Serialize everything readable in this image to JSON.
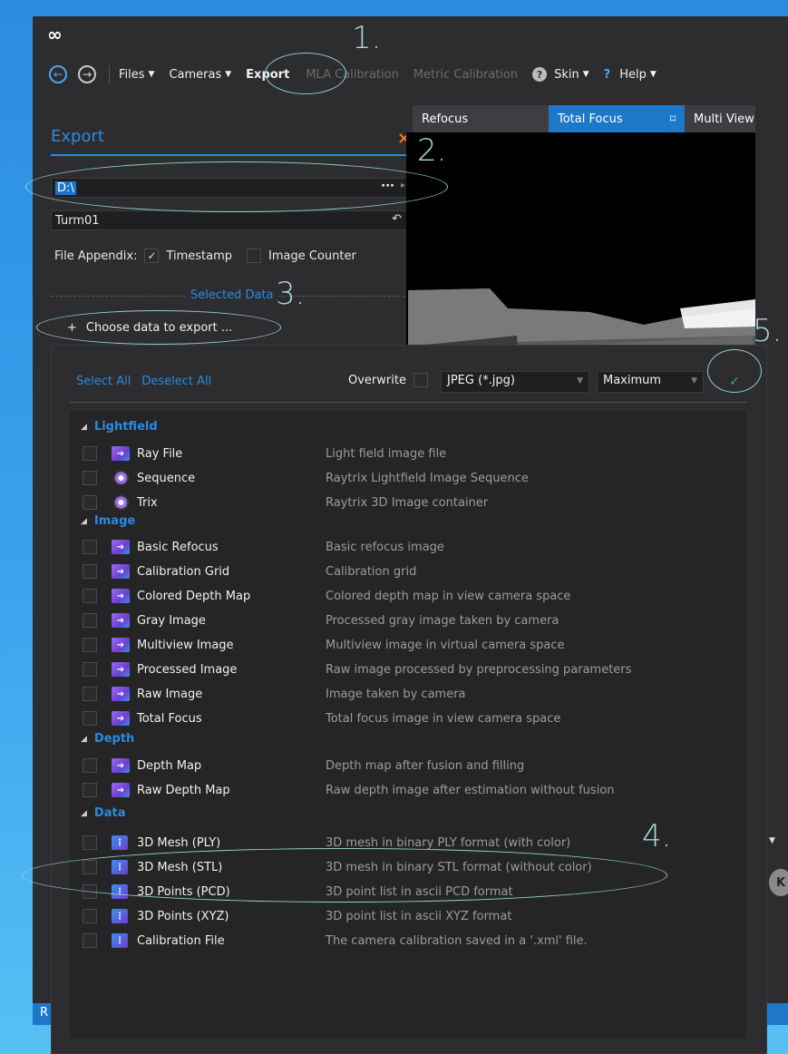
{
  "app": {
    "logo": "∞"
  },
  "toolbar": {
    "back_icon": "←",
    "forward_icon": "→",
    "files_label": "Files",
    "cameras_label": "Cameras",
    "export_label": "Export",
    "mla_label": "MLA Calibration",
    "metric_label": "Metric Calibration",
    "skin_label": "Skin",
    "help_label": "Help"
  },
  "panel": {
    "title": "Export",
    "close_icon": "×",
    "path_value": "D:\\",
    "path_more": "···",
    "name_value": "Turm01",
    "appendix_label": "File Appendix:",
    "timestamp_label": "Timestamp",
    "timestamp_checked": true,
    "counter_label": "Image Counter",
    "counter_checked": false,
    "selected_data_label": "Selected Data",
    "choose_plus": "+",
    "choose_label": "Choose data to export ..."
  },
  "view_tabs": {
    "refocus": "Refocus",
    "total_focus": "Total Focus",
    "multi_view": "Multi View",
    "focus_icon": "⌑"
  },
  "export_panel": {
    "select_all": "Select All",
    "deselect_all": "Deselect All",
    "overwrite_label": "Overwrite",
    "overwrite_checked": false,
    "format_value": "JPEG (*.jpg)",
    "quality_value": "Maximum",
    "confirm_icon": "✓"
  },
  "groups": {
    "lightfield": {
      "label": "Lightfield",
      "items": [
        {
          "name": "Ray File",
          "desc": "Light field image file"
        },
        {
          "name": "Sequence",
          "desc": "Raytrix Lightfield Image Sequence"
        },
        {
          "name": "Trix",
          "desc": "Raytrix 3D Image container"
        }
      ]
    },
    "image": {
      "label": "Image",
      "items": [
        {
          "name": "Basic Refocus",
          "desc": "Basic refocus image"
        },
        {
          "name": "Calibration Grid",
          "desc": "Calibration grid"
        },
        {
          "name": "Colored Depth Map",
          "desc": "Colored depth map in view camera space"
        },
        {
          "name": "Gray Image",
          "desc": "Processed gray image taken by camera"
        },
        {
          "name": "Multiview Image",
          "desc": "Multiview image in virtual camera space"
        },
        {
          "name": "Processed Image",
          "desc": "Raw image processed by preprocessing parameters"
        },
        {
          "name": "Raw Image",
          "desc": "Image taken by camera"
        },
        {
          "name": "Total Focus",
          "desc": "Total focus image in view camera space"
        }
      ]
    },
    "depth": {
      "label": "Depth",
      "items": [
        {
          "name": "Depth Map",
          "desc": "Depth map after fusion and filling"
        },
        {
          "name": "Raw Depth Map",
          "desc": "Raw depth image after estimation without fusion"
        }
      ]
    },
    "data": {
      "label": "Data",
      "items": [
        {
          "name": "3D Mesh (PLY)",
          "desc": "3D mesh in binary PLY format (with color)"
        },
        {
          "name": "3D Mesh (STL)",
          "desc": "3D mesh in binary STL format (without color)"
        },
        {
          "name": "3D Points (PCD)",
          "desc": "3D point list in ascii PCD format"
        },
        {
          "name": "3D Points (XYZ)",
          "desc": "3D point list in ascii XYZ format"
        },
        {
          "name": "Calibration File",
          "desc": "The camera calibration saved in a '.xml' file."
        }
      ]
    }
  },
  "annotations": {
    "n1": "1.",
    "n2": "2.",
    "n3": "3.",
    "n4": "4.",
    "n5": "5."
  },
  "side": {
    "badge": "K",
    "status_letter": "R"
  },
  "colors": {
    "accent": "#2a8ae0",
    "close": "#f07a21",
    "confirm": "#37b24d",
    "annotation": "#8fd0c6"
  }
}
